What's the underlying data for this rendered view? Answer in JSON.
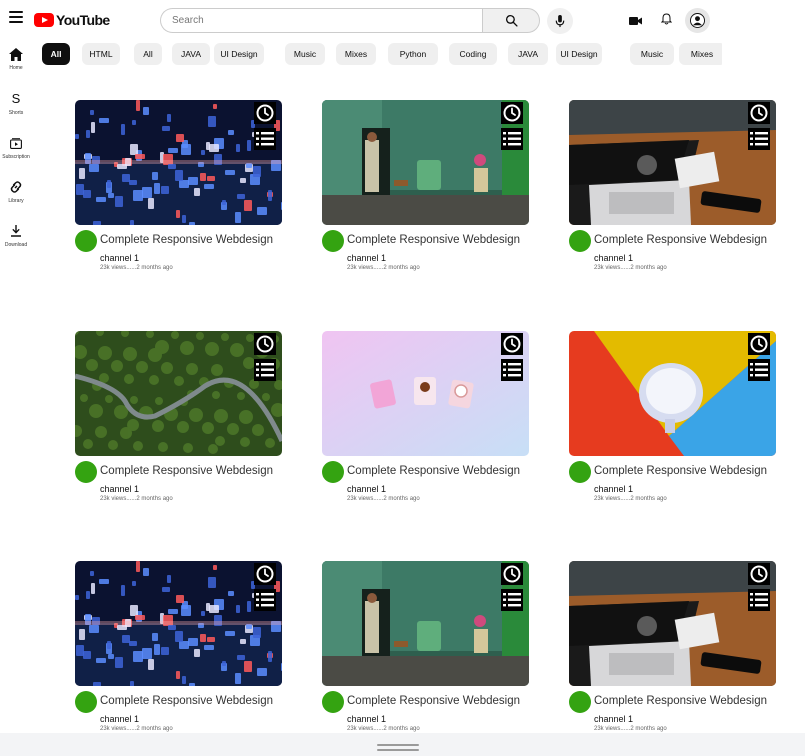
{
  "header": {
    "logo_text": "YouTube",
    "search_placeholder": "Search"
  },
  "chips": [
    "All",
    "HTML",
    "All",
    "JAVA",
    "UI Design",
    "Music",
    "Mixes",
    "Python",
    "Coding",
    "JAVA",
    "UI Design",
    "Music",
    "Mixes"
  ],
  "active_chip_index": 0,
  "sidebar": [
    {
      "label": "Home",
      "icon": "home-icon"
    },
    {
      "label": "Shorts",
      "icon": "shorts-icon"
    },
    {
      "label": "Subscription",
      "icon": "subscription-icon"
    },
    {
      "label": "Library",
      "icon": "library-icon"
    },
    {
      "label": "Download",
      "icon": "download-icon"
    }
  ],
  "videos": [
    {
      "thumb": "crystals",
      "title": "Complete Responsive Webdesign",
      "channel": "channel 1",
      "meta": "23k views......2 months ago"
    },
    {
      "thumb": "village",
      "title": "Complete Responsive Webdesign",
      "channel": "channel 1",
      "meta": "23k views......2 months ago"
    },
    {
      "thumb": "desk",
      "title": "Complete Responsive Webdesign",
      "channel": "channel 1",
      "meta": "23k views......2 months ago"
    },
    {
      "thumb": "forest",
      "title": "Complete Responsive Webdesign",
      "channel": "channel 1",
      "meta": "23k views......2 months ago"
    },
    {
      "thumb": "cubes",
      "title": "Complete Responsive Webdesign",
      "channel": "channel 1",
      "meta": "23k views......2 months ago"
    },
    {
      "thumb": "cup",
      "title": "Complete Responsive Webdesign",
      "channel": "channel 1",
      "meta": "23k views......2 months ago"
    },
    {
      "thumb": "crystals",
      "title": "Complete Responsive Webdesign",
      "channel": "channel 1",
      "meta": "23k views......2 months ago"
    },
    {
      "thumb": "village",
      "title": "Complete Responsive Webdesign",
      "channel": "channel 1",
      "meta": "23k views......2 months ago"
    },
    {
      "thumb": "desk",
      "title": "Complete Responsive Webdesign",
      "channel": "channel 1",
      "meta": "23k views......2 months ago"
    }
  ],
  "colors": {
    "brand_red": "#ff0000",
    "channel_avatar": "#34a311",
    "chip_active_bg": "#0f0f0f",
    "chip_bg": "#efefef"
  }
}
